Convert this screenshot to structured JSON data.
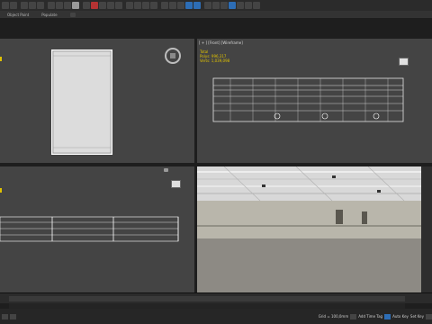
{
  "ribbon": {
    "tabs": [
      "Object Paint",
      "Populate"
    ]
  },
  "viewports": {
    "top_left": {
      "label": ""
    },
    "top_right": {
      "label": "[ + ] [Front] [Wireframe]",
      "stats": [
        "Total",
        "Polys: 996,317",
        "Verts: 1,039,098"
      ]
    },
    "bottom_left": {
      "label": ""
    },
    "bottom_right": {
      "label": ""
    }
  },
  "statusbar": {
    "grid": "Grid = 100,0mm",
    "add_time_tag": "Add Time Tag",
    "auto_key": "Auto Key",
    "set_key": "Set Key"
  }
}
